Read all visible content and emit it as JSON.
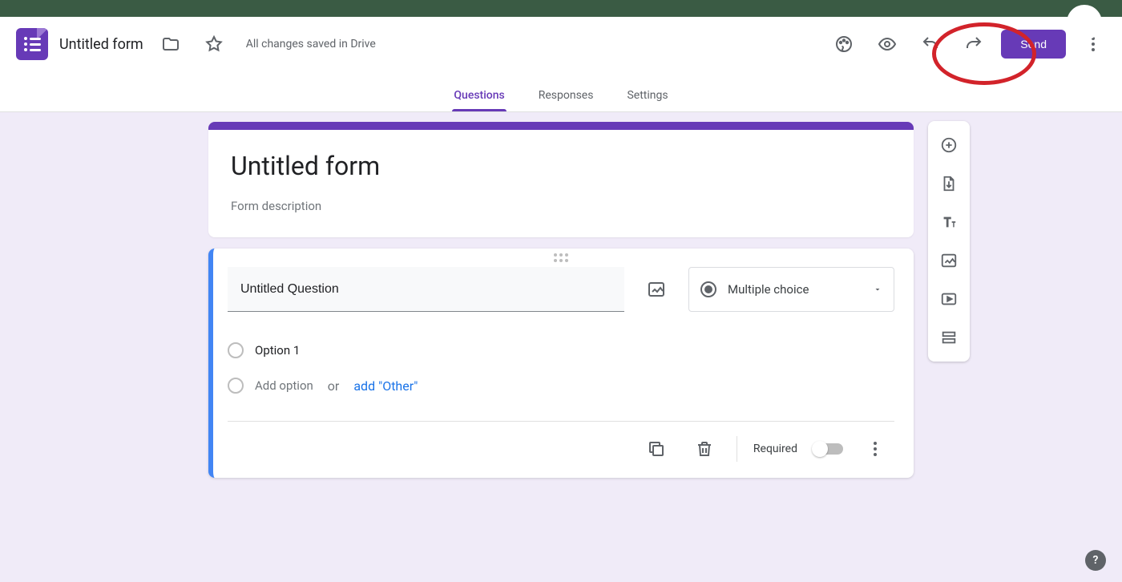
{
  "header": {
    "doc_title": "Untitled form",
    "save_status": "All changes saved in Drive",
    "send_label": "Send"
  },
  "tabs": {
    "questions": "Questions",
    "responses": "Responses",
    "settings": "Settings",
    "active": "questions"
  },
  "form": {
    "title": "Untitled form",
    "description_placeholder": "Form description"
  },
  "question": {
    "title": "Untitled Question",
    "type_label": "Multiple choice",
    "option1": "Option 1",
    "add_option": "Add option",
    "or": "or",
    "add_other": "add \"Other\"",
    "required_label": "Required"
  },
  "side_toolbar": {
    "add_question": "add-question",
    "import_questions": "import-questions",
    "add_title": "add-title-description",
    "add_image": "add-image",
    "add_video": "add-video",
    "add_section": "add-section"
  },
  "help": "?"
}
